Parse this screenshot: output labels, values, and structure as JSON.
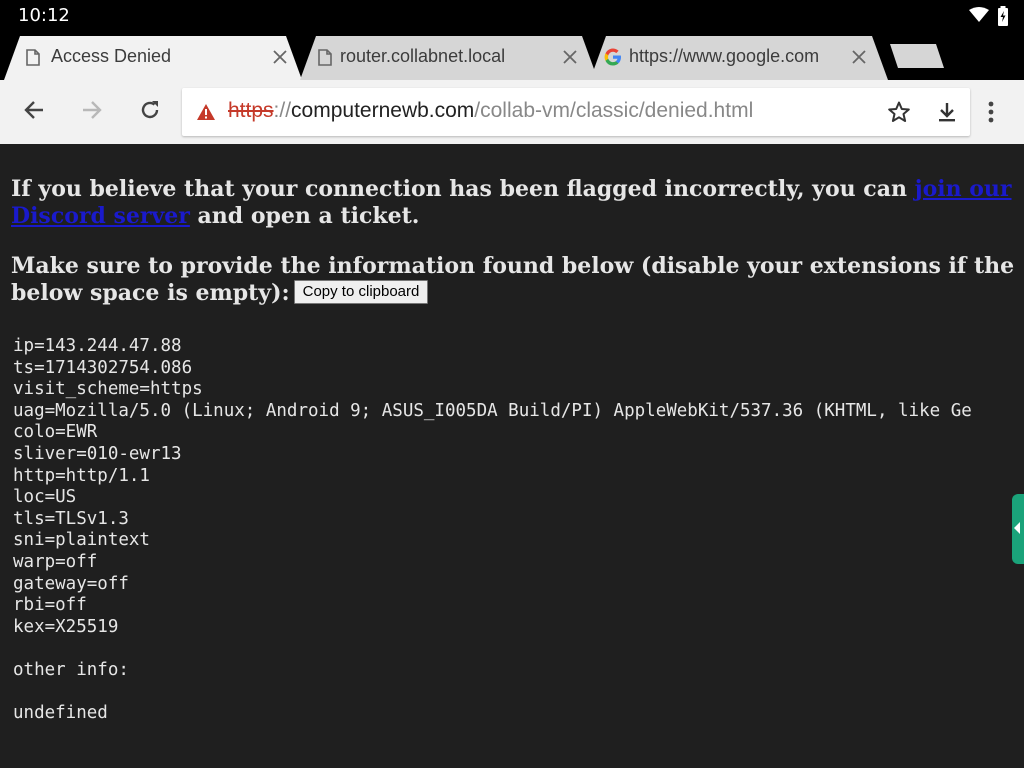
{
  "status_bar": {
    "time": "10:12"
  },
  "tabs": [
    {
      "title": "Access Denied",
      "active": true
    },
    {
      "title": "router.collabnet.local",
      "active": false
    },
    {
      "title": "https://www.google.com",
      "active": false
    }
  ],
  "omnibox": {
    "scheme": "https",
    "separator": "://",
    "host": "computernewb.com",
    "path": "/collab-vm/classic/denied.html"
  },
  "page": {
    "para1_text": "If you believe that your connection has been flagged incorrectly, you can ",
    "para1_link": "join our Discord server",
    "para1_end": " and open a ticket.",
    "para2_text": "Make sure to provide the information found below (disable your extensions if the below space is empty):",
    "copy_button": "Copy to clipboard",
    "trace": [
      "ip=143.244.47.88",
      "ts=1714302754.086",
      "visit_scheme=https",
      "uag=Mozilla/5.0 (Linux; Android 9; ASUS_I005DA Build/PI) AppleWebKit/537.36 (KHTML, like Ge",
      "colo=EWR",
      "sliver=010-ewr13",
      "http=http/1.1",
      "loc=US",
      "tls=TLSv1.3",
      "sni=plaintext",
      "warp=off",
      "gateway=off",
      "rbi=off",
      "kex=X25519",
      "",
      "other info:",
      "",
      "undefined"
    ]
  },
  "colors": {
    "page_background": "#1f1f1f",
    "link": "#1a1acc",
    "insecure_scheme": "#c53929",
    "side_handle": "#1aa37a"
  }
}
